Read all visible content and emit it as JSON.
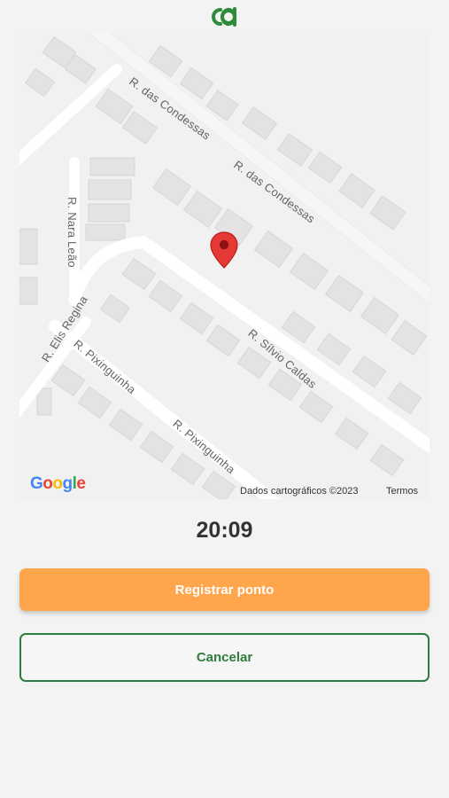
{
  "app": {
    "logo_icon": "cd-logo-icon",
    "brand_color": "#2e8b3a"
  },
  "map": {
    "streets": {
      "condessas_1": "R. das Condessas",
      "condessas_2": "R. das Condessas",
      "nara_leao": "R. Nara Leão",
      "elis_regina": "R. Elis Regina",
      "pixinguinha_1": "R. Pixinguinha",
      "pixinguinha_2": "R. Pixinguinha",
      "silvio_caldas": "R. Sílvio Caldas"
    },
    "google_logo": "Google",
    "attribution": "Dados cartográficos ©2023",
    "terms": "Termos",
    "marker_icon": "map-pin-icon",
    "marker_color": "#e53935"
  },
  "clock": {
    "time": "20:09"
  },
  "actions": {
    "register_label": "Registrar ponto",
    "register_color": "#ffa64d",
    "cancel_label": "Cancelar",
    "cancel_color": "#2e7d3e"
  }
}
